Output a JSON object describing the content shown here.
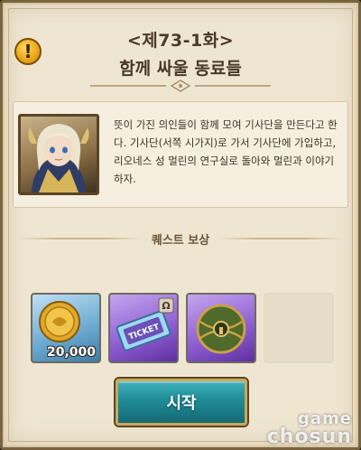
{
  "dialog": {
    "chapter_label": "<제73-1화>",
    "quest_title": "함께 싸울 동료들",
    "alert_glyph": "!",
    "description": "뜻이 가진 의인들이 함께 모여 기사단을 만든다고 한다. 기사단(서쪽 시가지)로 가서 기사단에 가입하고, 리오네스 성 멀린의 연구실로 돌아와 멀린과 이야기하자.",
    "reward_header": "퀘스트 보상",
    "rewards": [
      {
        "icon": "gold-coin-icon",
        "quantity": "20,000"
      },
      {
        "icon": "ticket-icon",
        "label": "TICKET",
        "grade": "Ω"
      },
      {
        "icon": "orb-icon"
      },
      {
        "icon": "empty-slot"
      }
    ],
    "start_label": "시작"
  },
  "watermark": {
    "line1": "game",
    "line2": "chosun"
  },
  "colors": {
    "accent": "#1f8b97",
    "text": "#3c3226",
    "border": "#7a6440"
  }
}
